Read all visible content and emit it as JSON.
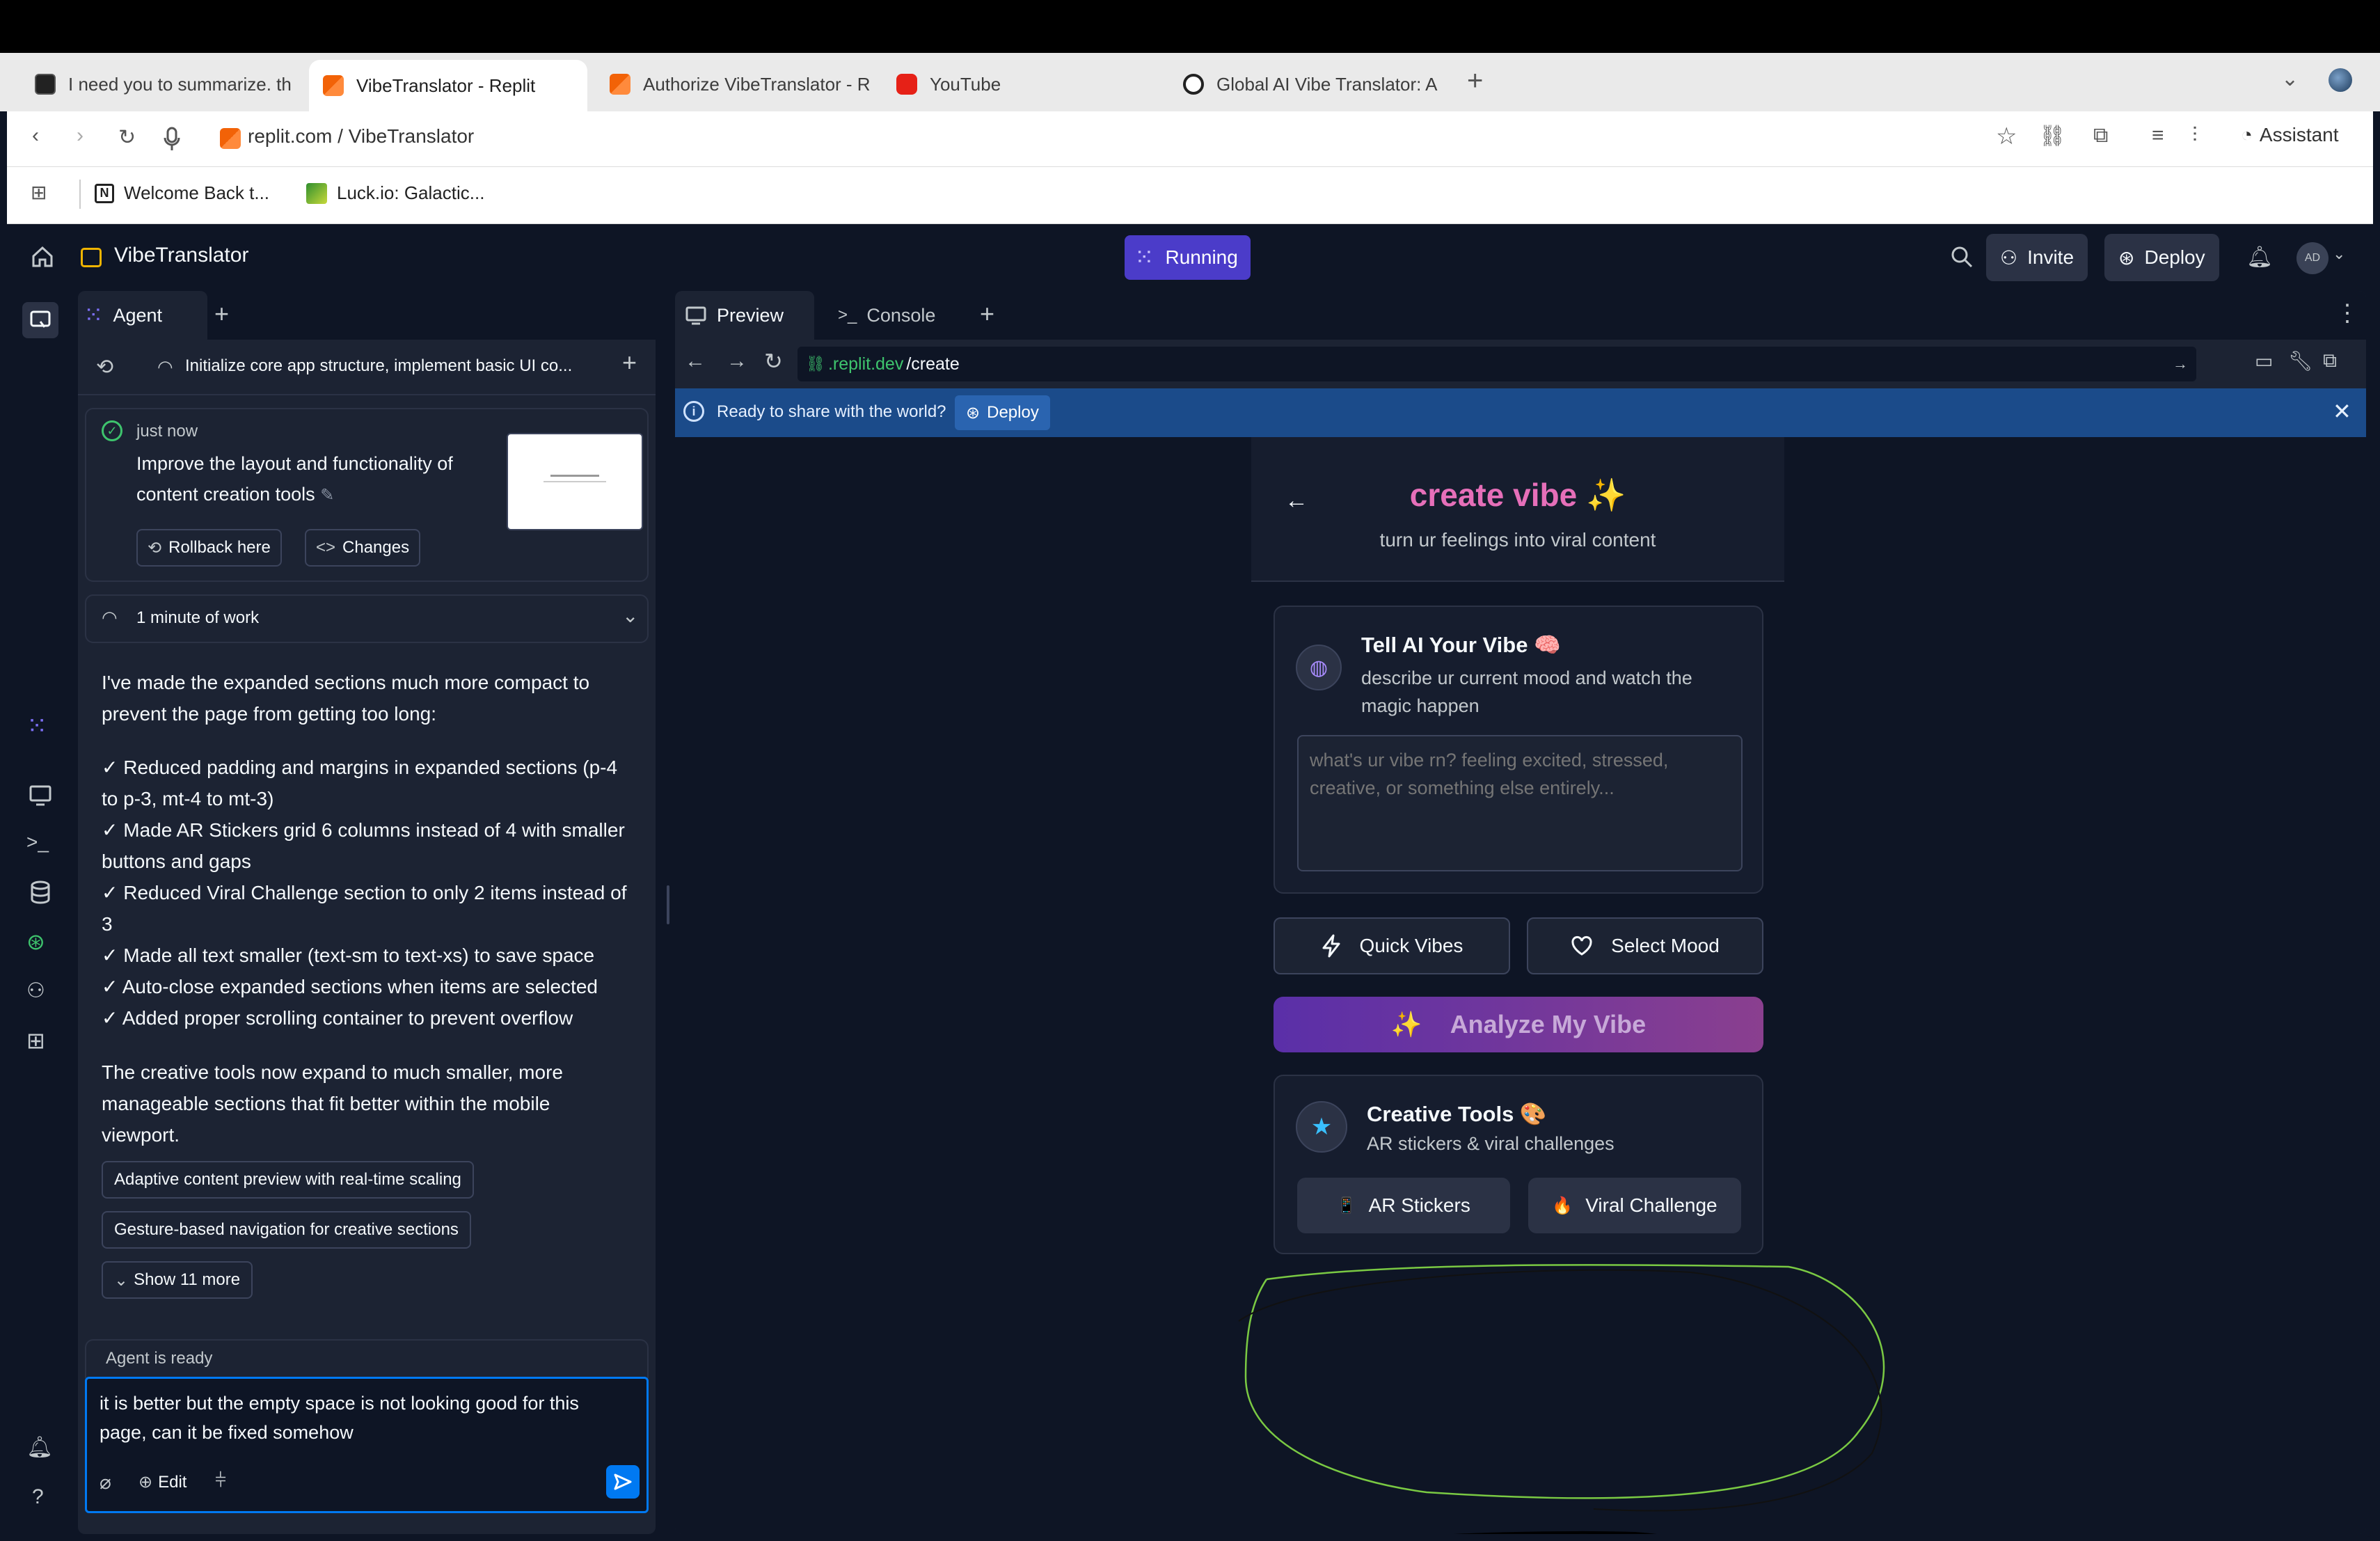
{
  "browser": {
    "tabs": [
      {
        "label": "I need you to summarize. th",
        "icon": "notion-icon"
      },
      {
        "label": "VibeTranslator - Replit",
        "icon": "replit-icon",
        "active": true
      },
      {
        "label": "Authorize VibeTranslator - R",
        "icon": "replit-icon"
      },
      {
        "label": "YouTube",
        "icon": "youtube-icon"
      },
      {
        "label": "Global AI Vibe Translator: A",
        "icon": "openai-icon"
      }
    ],
    "url": "replit.com / VibeTranslator",
    "assistant_label": "Assistant",
    "bookmarks": [
      "Welcome Back t...",
      "Luck.io: Galactic..."
    ]
  },
  "app": {
    "project_name": "VibeTranslator",
    "status": "Running",
    "invite_label": "Invite",
    "deploy_label": "Deploy",
    "avatar": "AD",
    "accent": "#5b4bd8"
  },
  "agent": {
    "tab_label": "Agent",
    "checkpoint_title": "Initialize core app structure, implement basic UI co...",
    "checkpoint_time": "just now",
    "checkpoint_desc": "Improve the layout and functionality of content creation tools",
    "rollback_label": "Rollback here",
    "changes_label": "Changes",
    "work_label": "1 minute of work",
    "message_intro": "I've made the expanded sections much more compact to prevent the page from getting too long:",
    "bullets": [
      "✓ Reduced padding and margins in expanded sections (p-4 to p-3, mt-4 to mt-3)",
      "✓ Made AR Stickers grid 6 columns instead of 4 with smaller buttons and gaps",
      "✓ Reduced Viral Challenge section to only 2 items instead of 3",
      "✓ Made all text smaller (text-sm to text-xs) to save space",
      "✓ Auto-close expanded sections when items are selected",
      "✓ Added proper scrolling container to prevent overflow"
    ],
    "message_outro": "The creative tools now expand to much smaller, more manageable sections that fit better within the mobile viewport.",
    "suggestions": [
      "Adaptive content preview with real-time scaling",
      "Gesture-based navigation for creative sections"
    ],
    "show_more": "Show 11 more",
    "status_label": "Agent is ready",
    "input_value": "it is better but the empty space is not looking good for this page, can it be fixed somehow",
    "edit_label": "Edit"
  },
  "preview": {
    "tab_preview": "Preview",
    "tab_console": "Console",
    "url_prefix": ".replit.dev",
    "url_path": "/create",
    "banner_text": "Ready to share with the world?",
    "banner_button": "Deploy",
    "page": {
      "title": "create vibe ✨",
      "subtitle": "turn ur feelings into viral content",
      "tell_title": "Tell AI Your Vibe 🧠",
      "tell_desc": "describe ur current mood and watch the magic happen",
      "textarea_placeholder": "what's ur vibe rn? feeling excited, stressed, creative, or something else entirely...",
      "quick_vibes": "Quick Vibes",
      "select_mood": "Select Mood",
      "analyze": "Analyze My Vibe",
      "analyze_icon": "✨",
      "creative_title": "Creative Tools 🎨",
      "creative_desc": "AR stickers & viral challenges",
      "ar_stickers": "AR Stickers",
      "ar_icon": "📱",
      "viral_challenge": "Viral Challenge",
      "viral_icon": "🔥",
      "title_color": "#e66fb9"
    }
  }
}
